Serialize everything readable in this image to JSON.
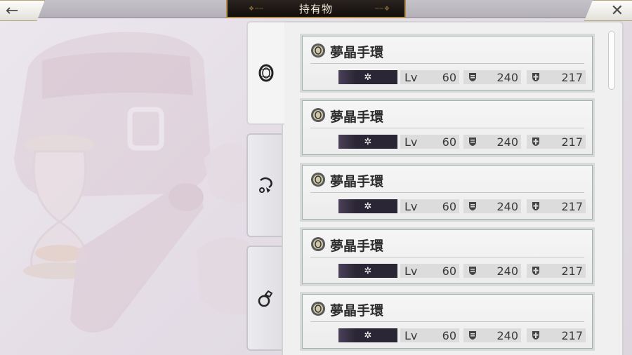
{
  "header": {
    "title": "持有物",
    "back_icon": "arrow-left-icon",
    "close_icon": "close-x-icon"
  },
  "tabs": [
    {
      "icon": "bracelet-icon",
      "active": true
    },
    {
      "icon": "earring-icon",
      "active": false
    },
    {
      "icon": "ring-icon",
      "active": false
    }
  ],
  "items": [
    {
      "name": "夢晶手環",
      "element_symbol": "✲",
      "lv_label": "Lv",
      "level": "60",
      "attack": "240",
      "defense": "217"
    },
    {
      "name": "夢晶手環",
      "element_symbol": "✲",
      "lv_label": "Lv",
      "level": "60",
      "attack": "240",
      "defense": "217"
    },
    {
      "name": "夢晶手環",
      "element_symbol": "✲",
      "lv_label": "Lv",
      "level": "60",
      "attack": "240",
      "defense": "217"
    },
    {
      "name": "夢晶手環",
      "element_symbol": "✲",
      "lv_label": "Lv",
      "level": "60",
      "attack": "240",
      "defense": "217"
    },
    {
      "name": "夢晶手環",
      "element_symbol": "✲",
      "lv_label": "Lv",
      "level": "60",
      "attack": "240",
      "defense": "217"
    }
  ],
  "colors": {
    "title_bg": "#1b1512",
    "title_border": "#b58f4d",
    "element_badge": "#2b2636",
    "item_border_accent": "#9fb3ae"
  }
}
